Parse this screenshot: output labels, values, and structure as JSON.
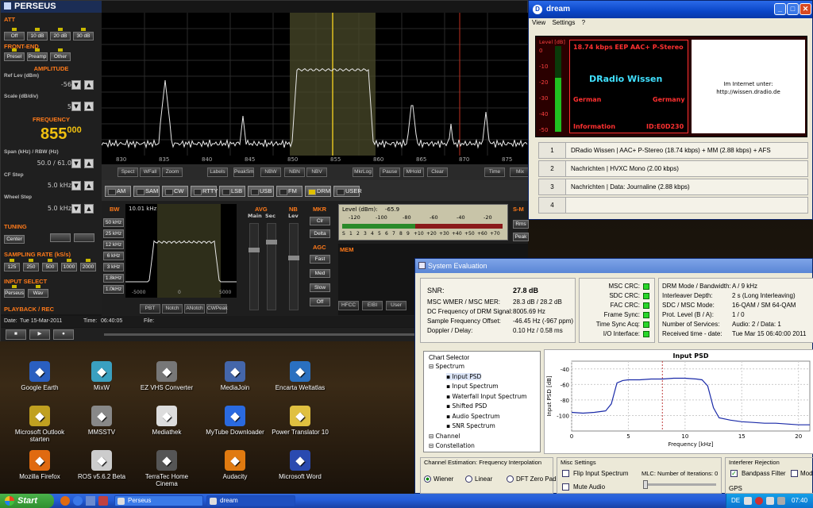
{
  "desktop": {
    "icons": [
      {
        "label": "Google Earth",
        "icon": "google-earth-icon",
        "color": "#2a5fc0"
      },
      {
        "label": "MixW",
        "icon": "mixw-icon",
        "color": "#3aa0c0"
      },
      {
        "label": "EZ VHS Converter",
        "icon": "ez-vhs-icon",
        "color": "#777777"
      },
      {
        "label": "MediaJoin",
        "icon": "mediajoin-icon",
        "color": "#4466aa"
      },
      {
        "label": "Encarta Weltatlas",
        "icon": "encarta-icon",
        "color": "#2a70c0"
      },
      {
        "label": "Microsoft Outlook starten",
        "icon": "outlook-icon",
        "color": "#c0a020"
      },
      {
        "label": "MMSSTV",
        "icon": "mmsstv-icon",
        "color": "#888888"
      },
      {
        "label": "Mediathek",
        "icon": "mediathek-icon",
        "color": "#dddddd"
      },
      {
        "label": "MyTube Downloader",
        "icon": "mytube-icon",
        "color": "#2a6ae0"
      },
      {
        "label": "Power Translator 10",
        "icon": "translator-icon",
        "color": "#e0c040"
      },
      {
        "label": "Mozilla Firefox",
        "icon": "firefox-icon",
        "color": "#e06a10"
      },
      {
        "label": "ROS v5.6.2 Beta",
        "icon": "ros-icon",
        "color": "#cccccc"
      },
      {
        "label": "TerraTec Home Cinema",
        "icon": "terratec-icon",
        "color": "#555555"
      },
      {
        "label": "Audacity",
        "icon": "audacity-icon",
        "color": "#e07a10"
      },
      {
        "label": "Microsoft Word",
        "icon": "word-icon",
        "color": "#2a4ab0"
      }
    ]
  },
  "perseus": {
    "title": "PERSEUS",
    "att": {
      "label": "ATT",
      "buttons": [
        "Off",
        "10 dB",
        "20 dB",
        "30 dB"
      ]
    },
    "frontend": {
      "label": "FRONT-END",
      "buttons": [
        "Presel",
        "Preamp",
        "Other"
      ]
    },
    "amplitude": {
      "label": "AMPLITUDE",
      "ref_label": "Ref Lev (dBm)",
      "ref_value": "-56",
      "scale_label": "Scale (dB/div)",
      "scale_value": "5"
    },
    "frequency": {
      "label": "FREQUENCY",
      "main": "855",
      "sub": "000"
    },
    "span": {
      "label": "Span (kHz) / RBW (Hz)",
      "value": "50.0 / 61.0"
    },
    "cf_step": {
      "label": "CF Step",
      "value": "5.0 kHz"
    },
    "wheel_step": {
      "label": "Wheel Step",
      "value": "5.0 kHz"
    },
    "tuning": {
      "label": "TUNING",
      "center": "Center"
    },
    "sampling": {
      "label": "SAMPLING RATE (kS/s)",
      "buttons": [
        "125",
        "250",
        "500",
        "1000",
        "2000"
      ]
    },
    "input": {
      "label": "INPUT SELECT",
      "buttons": [
        "Perseus",
        "Wav"
      ]
    },
    "playback": {
      "label": "PLAYBACK / REC",
      "date_label": "Date:",
      "date": "Tue 15-Mar-2011",
      "time_label": "Time:",
      "time": "06:40:05",
      "file_label": "File:"
    },
    "freq_ticks": [
      "830",
      "835",
      "840",
      "845",
      "850",
      "855",
      "860",
      "865",
      "870",
      "875"
    ],
    "toolbar": [
      "Spect",
      "WFall",
      "Zoom",
      "Labels",
      "PeakSm",
      "NBW",
      "NBN",
      "NBV",
      "MkrLog",
      "Pause",
      "MHold",
      "Clear",
      "Time",
      "Mix"
    ],
    "modes": [
      {
        "label": "AM",
        "on": false
      },
      {
        "label": "SAM",
        "on": false
      },
      {
        "label": "CW",
        "on": false
      },
      {
        "label": "RTTY",
        "on": false
      },
      {
        "label": "LSB",
        "on": false
      },
      {
        "label": "USB",
        "on": false
      },
      {
        "label": "FM",
        "on": false
      },
      {
        "label": "DRM",
        "on": true
      },
      {
        "label": "USER",
        "on": false
      }
    ],
    "bw": {
      "label": "BW",
      "buttons": [
        "50 kHz",
        "25 kHz",
        "12 kHz",
        "6 kHz",
        "3 kHz",
        "1.8kHz",
        "1.0kHz"
      ]
    },
    "zoom": {
      "label": "10.01 kHz",
      "ticks": [
        "-5000",
        "0",
        "5000"
      ]
    },
    "zoom_buttons": [
      "PBT",
      "Notch",
      "ANotch",
      "CWPeak"
    ],
    "avg": {
      "label": "AVG",
      "main": "Main",
      "sec": "Sec"
    },
    "nb": {
      "label": "NB",
      "lev": "Lev"
    },
    "mkr": {
      "label": "MKR",
      "buttons": [
        "Clr",
        "Delta"
      ]
    },
    "agc": {
      "label": "AGC",
      "buttons": [
        "Fast",
        "Med",
        "Slow",
        "Off"
      ]
    },
    "level": {
      "label": "Level (dBm):",
      "value": "-65.9",
      "scale_top": [
        "-120",
        "-100",
        "-80",
        "-60",
        "-40",
        "-20"
      ],
      "scale_bottom": [
        "S",
        "1",
        "2",
        "3",
        "4",
        "5",
        "6",
        "7",
        "8",
        "9",
        "+10",
        "+20",
        "+30",
        "+40",
        "+50",
        "+60",
        "+70"
      ]
    },
    "smeter": {
      "label": "S-M",
      "buttons": [
        "Rms",
        "Peak"
      ]
    },
    "mem": {
      "label": "MEM",
      "buttons": [
        "HFCC",
        "EIBI",
        "User"
      ]
    }
  },
  "dream": {
    "title": "dream",
    "menu": [
      "View",
      "Settings",
      "?"
    ],
    "level_label": "Level [dB]",
    "level_ticks": [
      "0",
      "-10",
      "-20",
      "-30",
      "-40",
      "-50"
    ],
    "info_line": "18.74 kbps EEP  AAC+  P-Stereo",
    "station": "DRadio Wissen",
    "language": "German",
    "country": "Germany",
    "program_type": "Information",
    "id": "ID:E0D230",
    "image_text_line1": "Im Internet unter:",
    "image_text_line2": "http://wissen.dradio.de",
    "services": [
      {
        "num": "1",
        "text": "DRadio Wissen  |  AAC+ P-Stereo (18.74 kbps) + MM (2.88 kbps) + AFS"
      },
      {
        "num": "2",
        "text": "Nachrichten  |  HVXC Mono (2.00 kbps)"
      },
      {
        "num": "3",
        "text": "Nachrichten  |  Data: Journaline (2.88 kbps)"
      },
      {
        "num": "4",
        "text": ""
      }
    ]
  },
  "syseval": {
    "title": "System Evaluation",
    "snr_label": "SNR:",
    "snr": "27.8 dB",
    "rows": [
      {
        "label": "MSC WMER / MSC MER:",
        "value": "28.3 dB / 28.2 dB"
      },
      {
        "label": "DC Frequency of DRM Signal:",
        "value": "8005.69 Hz"
      },
      {
        "label": "Sample Frequency Offset:",
        "value": "-46.45 Hz (-967 ppm)"
      },
      {
        "label": "Doppler / Delay:",
        "value": "0.10 Hz / 0.58 ms"
      }
    ],
    "crc": [
      "MSC CRC:",
      "SDC CRC:",
      "FAC CRC:",
      "Frame Sync:",
      "Time Sync Acq:",
      "I/O Interface:"
    ],
    "mode_rows": [
      {
        "label": "DRM Mode / Bandwidth:",
        "value": "A / 9 kHz"
      },
      {
        "label": "Interleaver Depth:",
        "value": "2 s (Long Interleaving)"
      },
      {
        "label": "SDC / MSC Mode:",
        "value": "16-QAM / SM 64-QAM"
      },
      {
        "label": "Prot. Level (B / A):",
        "value": "1 / 0"
      },
      {
        "label": "Number of Services:",
        "value": "Audio: 2 / Data: 1"
      },
      {
        "label": "Received time - date:",
        "value": "Tue Mar 15 06:40:00 2011"
      }
    ],
    "chart_selector": "Chart Selector",
    "tree": [
      "Spectrum",
      "Input PSD",
      "Input Spectrum",
      "Waterfall Input Spectrum",
      "Shifted PSD",
      "Audio Spectrum",
      "SNR Spectrum",
      "Channel",
      "Constellation"
    ],
    "channel_est": {
      "label": "Channel Estimation: Frequency Interpolation",
      "options": [
        "Wiener",
        "Linear",
        "DFT Zero Pad."
      ]
    },
    "misc": {
      "label": "Misc Settings",
      "flip": "Flip Input Spectrum",
      "mute": "Mute Audio",
      "mlc": "MLC: Number of Iterations: 0"
    },
    "interferer": {
      "label": "Interferer Rejection",
      "bandpass": "Bandpass Filter",
      "modified": "Modif",
      "gps": "GPS"
    }
  },
  "chart_data": {
    "type": "line",
    "title": "Input PSD",
    "xlabel": "Frequency [kHz]",
    "ylabel": "Input PSD [dB]",
    "xlim": [
      0,
      21
    ],
    "ylim": [
      -120,
      -30
    ],
    "xticks": [
      "0",
      "5",
      "10",
      "15",
      "20"
    ],
    "yticks": [
      "-40",
      "-60",
      "-80",
      "-100"
    ],
    "grid": true,
    "x": [
      0,
      1,
      2,
      3,
      3.5,
      4,
      4.5,
      5,
      6,
      7,
      8,
      9,
      10,
      11,
      11.5,
      12,
      12.5,
      13,
      14,
      15,
      16,
      17,
      18,
      19,
      20,
      21
    ],
    "values": [
      -96,
      -97,
      -96,
      -94,
      -85,
      -58,
      -55,
      -54,
      -54,
      -53,
      -53,
      -52,
      -52,
      -53,
      -54,
      -62,
      -90,
      -103,
      -106,
      -108,
      -109,
      -110,
      -110,
      -111,
      -112,
      -112
    ],
    "marker_x": 8
  },
  "taskbar": {
    "start": "Start",
    "apps": [
      {
        "label": "Perseus",
        "active": false
      },
      {
        "label": "dream",
        "active": true
      }
    ],
    "lang": "DE",
    "clock": "07:40"
  }
}
